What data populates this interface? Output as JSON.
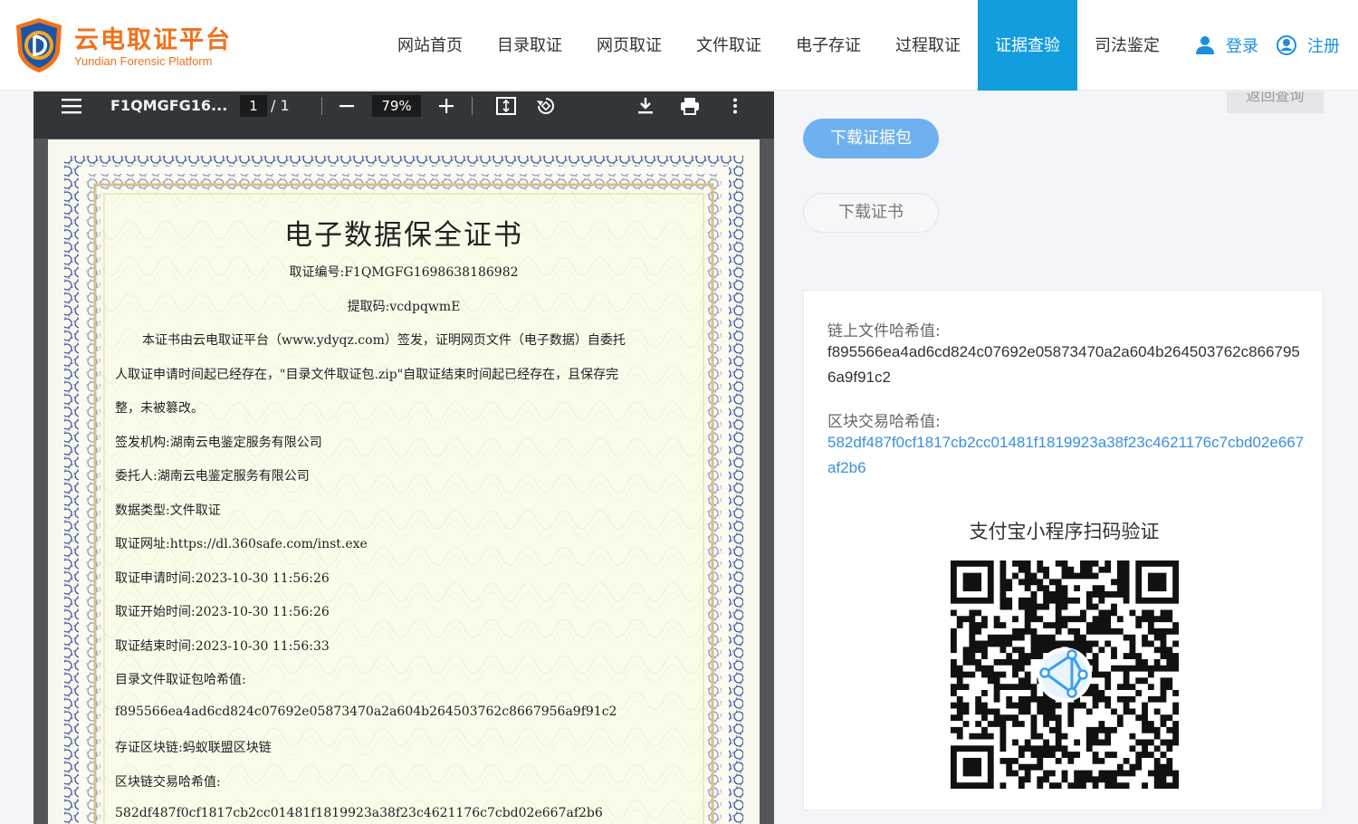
{
  "brand": {
    "name_cn": "云电取证平台",
    "name_en": "Yundian Forensic Platform",
    "logo_color": "#f0721c"
  },
  "nav": {
    "items": [
      {
        "label": "网站首页",
        "active": false
      },
      {
        "label": "目录取证",
        "active": false
      },
      {
        "label": "网页取证",
        "active": false
      },
      {
        "label": "文件取证",
        "active": false
      },
      {
        "label": "电子存证",
        "active": false
      },
      {
        "label": "过程取证",
        "active": false
      },
      {
        "label": "证据查验",
        "active": true
      },
      {
        "label": "司法鉴定",
        "active": false
      }
    ],
    "login": "登录",
    "register": "注册",
    "accent": "#129ddf"
  },
  "pdf": {
    "title": "F1QMGFG16...",
    "page_current": "1",
    "page_total": "/ 1",
    "zoom": "79%",
    "cert": {
      "title": "电子数据保全证书",
      "evidence_no": "取证编号:F1QMGFG1698638186982",
      "extract_code": "提取码:vcdpqwmE",
      "body_1": "本证书由云电取证平台（www.ydyqz.com）签发，证明网页文件（电子数据）自委托",
      "body_2": "人取证申请时间起已经存在，\"目录文件取证包.zip\"自取证结束时间起已经存在，且保存完",
      "body_3": "整，未被篡改。",
      "issuer": "签发机构:湖南云电鉴定服务有限公司",
      "client": "委托人:湖南云电鉴定服务有限公司",
      "data_type": "数据类型:文件取证",
      "url": "取证网址:https://dl.360safe.com/inst.exe",
      "apply_time": "取证申请时间:2023-10-30 11:56:26",
      "start_time": "取证开始时间:2023-10-30 11:56:26",
      "end_time": "取证结束时间:2023-10-30 11:56:33",
      "pkg_hash_label": "目录文件取证包哈希值:",
      "pkg_hash": "f895566ea4ad6cd824c07692e05873470a2a604b264503762c8667956a9f91c2",
      "chain": "存证区块链:蚂蚁联盟区块链",
      "tx_hash_label": "区块链交易哈希值:",
      "tx_hash": "582df487f0cf1817cb2cc01481f1819923a38f23c4621176c7cbd02e667af2b6"
    }
  },
  "side": {
    "back": "返回查询",
    "download_pkg": "下载证据包",
    "download_cert": "下载证书",
    "file_hash_label": "链上文件哈希值:",
    "file_hash": "f895566ea4ad6cd824c07692e05873470a2a604b264503762c8667956a9f91c2",
    "tx_hash_label": "区块交易哈希值:",
    "tx_hash": "582df487f0cf1817cb2cc01481f1819923a38f23c4621176c7cbd02e667af2b6",
    "qr_title": "支付宝小程序扫码验证"
  }
}
